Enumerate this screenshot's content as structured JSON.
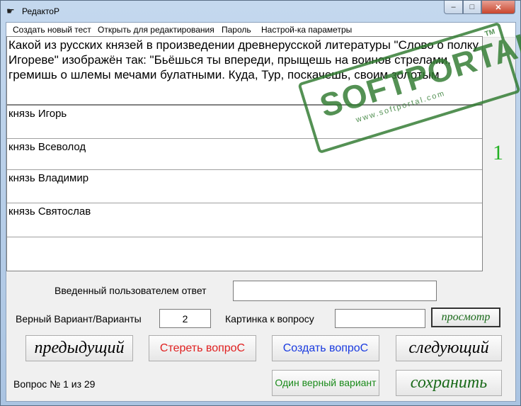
{
  "window": {
    "title": "РедактоР",
    "app_icon": "pointing-hand-icon",
    "minimize": "–",
    "maximize": "□",
    "close": "✕"
  },
  "menu": [
    "Создать новый тест",
    "Открыть для редактирования",
    "Пароль",
    "Настрой-ка параметры"
  ],
  "question": {
    "text": "Какой из русских князей в произведении древнерусской литературы \"Слово о полку Игореве\" изображён так: \"Бьёшься ты впереди, прыщешь на воинов стрелами, гремишь о шлемы мечами булатными. Куда, Тур, поскачешь, своим золотым",
    "number": "1"
  },
  "answers": [
    "князь Игорь",
    "князь Всеволод",
    "князь Владимир",
    "князь Святослав",
    ""
  ],
  "user_answer": {
    "label": "Введенный пользователем ответ",
    "value": ""
  },
  "correct_variant": {
    "label": "Верный Вариант/Варианты",
    "value": "2"
  },
  "picture": {
    "label": "Картинка к вопросу",
    "value": "",
    "preview_button": "просмотр"
  },
  "buttons": {
    "prev": "предыдущий",
    "delete": "Стереть вопроС",
    "create": "Создать вопроС",
    "next": "следующий",
    "single_answer": "Один верный вариант",
    "save": "сохранить"
  },
  "status": "Вопрос № 1 из 29",
  "watermark": {
    "main": "SOFTPORTAL",
    "sub": "www.softportal.com",
    "tm": "TM"
  },
  "colors": {
    "delete_button_text": "#e02020",
    "create_button_text": "#1a3be0",
    "single_answer_text": "#1a8a1a",
    "save_text": "#1a6a1a",
    "question_number": "#22b022"
  }
}
